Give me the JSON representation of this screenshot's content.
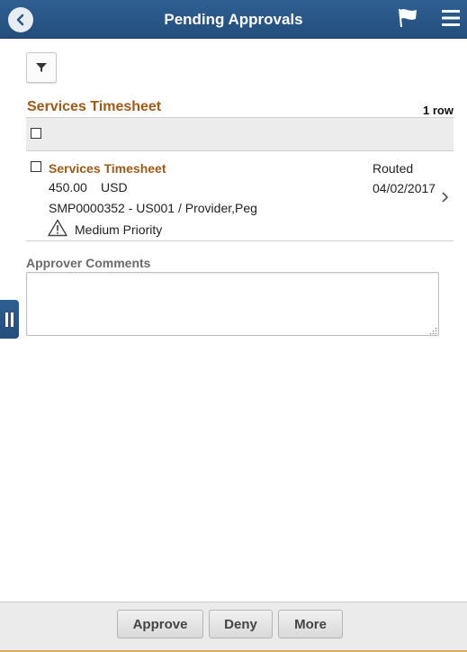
{
  "header": {
    "title": "Pending Approvals",
    "back_icon": "back-chevron-icon",
    "flag_icon": "flag-icon",
    "menu_icon": "hamburger-menu-icon",
    "background": "#2a5686"
  },
  "toolbar": {
    "filter_icon": "filter-icon"
  },
  "section": {
    "title": "Services Timesheet",
    "row_count": "1 row",
    "title_color": "#a05a17"
  },
  "items": [
    {
      "title": "Services Timesheet",
      "amount": "450.00",
      "currency": "USD",
      "reference": "SMP0000352 - US001 / Provider,Peg",
      "priority": "Medium Priority",
      "status": "Routed",
      "date": "04/02/2017",
      "checked": false
    }
  ],
  "comments": {
    "label": "Approver Comments",
    "value": "",
    "placeholder": ""
  },
  "footer": {
    "approve_label": "Approve",
    "deny_label": "Deny",
    "more_label": "More"
  }
}
